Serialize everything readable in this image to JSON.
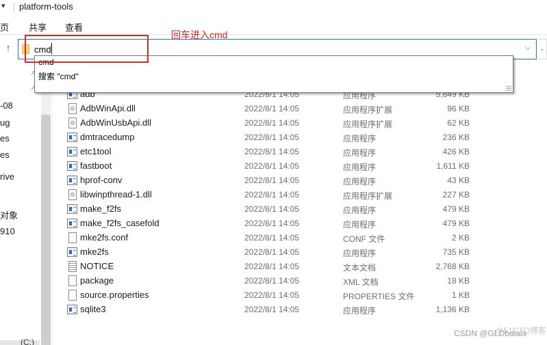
{
  "window": {
    "title": "platform-tools",
    "quick_access_arrow": "▾"
  },
  "ribbon": {
    "tabs": [
      {
        "label": "页"
      },
      {
        "label": "共享"
      },
      {
        "label": "查看"
      }
    ]
  },
  "address_bar": {
    "value": "cmd",
    "up_icon": "↑",
    "dropdown_icon": "⌵",
    "refresh_icon": "-"
  },
  "suggestions": [
    {
      "label": "cmd"
    },
    {
      "label": "搜索 \"cmd\""
    }
  ],
  "annotation": {
    "text": "回车进入cmd",
    "color": "#e02020"
  },
  "nav_pane": {
    "items": [
      {
        "label": "-08"
      },
      {
        "label": "ug"
      },
      {
        "label": "es"
      },
      {
        "label": "es"
      },
      {
        "label": "rive"
      },
      {
        "label": "对象"
      },
      {
        "label": "910"
      }
    ],
    "drive_label": "(C:)"
  },
  "files": [
    {
      "name": "adb",
      "date": "2022/8/1 14:05",
      "type": "应用程序",
      "size": "5,849 KB",
      "icon": "app-icon"
    },
    {
      "name": "AdbWinApi.dll",
      "date": "2022/8/1 14:05",
      "type": "应用程序扩展",
      "size": "96 KB",
      "icon": "dll-icon"
    },
    {
      "name": "AdbWinUsbApi.dll",
      "date": "2022/8/1 14:05",
      "type": "应用程序扩展",
      "size": "62 KB",
      "icon": "dll-icon"
    },
    {
      "name": "dmtracedump",
      "date": "2022/8/1 14:05",
      "type": "应用程序",
      "size": "236 KB",
      "icon": "app-icon"
    },
    {
      "name": "etc1tool",
      "date": "2022/8/1 14:05",
      "type": "应用程序",
      "size": "426 KB",
      "icon": "app-icon"
    },
    {
      "name": "fastboot",
      "date": "2022/8/1 14:05",
      "type": "应用程序",
      "size": "1,611 KB",
      "icon": "app-icon"
    },
    {
      "name": "hprof-conv",
      "date": "2022/8/1 14:05",
      "type": "应用程序",
      "size": "43 KB",
      "icon": "app-icon"
    },
    {
      "name": "libwinpthread-1.dll",
      "date": "2022/8/1 14:05",
      "type": "应用程序扩展",
      "size": "227 KB",
      "icon": "dll-icon"
    },
    {
      "name": "make_f2fs",
      "date": "2022/8/1 14:05",
      "type": "应用程序",
      "size": "479 KB",
      "icon": "app-icon"
    },
    {
      "name": "make_f2fs_casefold",
      "date": "2022/8/1 14:05",
      "type": "应用程序",
      "size": "479 KB",
      "icon": "app-icon"
    },
    {
      "name": "mke2fs.conf",
      "date": "2022/8/1 14:05",
      "type": "CONF 文件",
      "size": "2 KB",
      "icon": "file-icon"
    },
    {
      "name": "mke2fs",
      "date": "2022/8/1 14:05",
      "type": "应用程序",
      "size": "735 KB",
      "icon": "app-icon"
    },
    {
      "name": "NOTICE",
      "date": "2022/8/1 14:05",
      "type": "文本文档",
      "size": "2,768 KB",
      "icon": "text-file-icon"
    },
    {
      "name": "package",
      "date": "2022/8/1 14:05",
      "type": "XML 文档",
      "size": "18 KB",
      "icon": "file-icon"
    },
    {
      "name": "source.properties",
      "date": "2022/8/1 14:05",
      "type": "PROPERTIES 文件",
      "size": "1 KB",
      "icon": "file-icon"
    },
    {
      "name": "sqlite3",
      "date": "2022/8/1 14:05",
      "type": "应用程序",
      "size": "1,136 KB",
      "icon": "app-icon"
    }
  ],
  "watermark": {
    "primary": "CSDN @GLDbalala",
    "secondary": "@51CTO博客"
  },
  "colors": {
    "address_border": "#1b7cc1",
    "annotation": "#d42a2a",
    "folder": "#f8d775"
  }
}
